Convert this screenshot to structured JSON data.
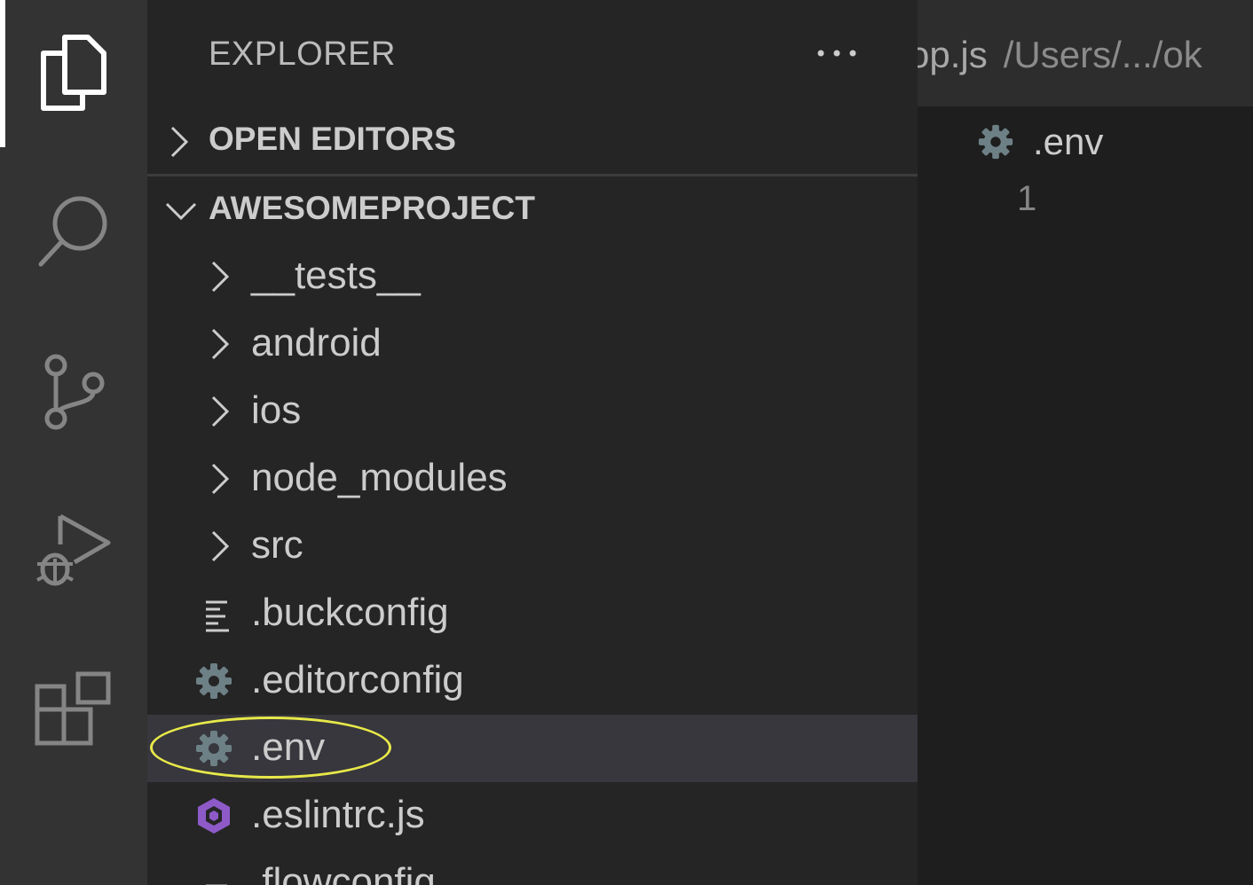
{
  "sidebar": {
    "title": "EXPLORER",
    "sections": [
      {
        "label": "OPEN EDITORS",
        "expanded": false
      },
      {
        "label": "AWESOMEPROJECT",
        "expanded": true
      }
    ],
    "tree": [
      {
        "name": "__tests__",
        "type": "folder"
      },
      {
        "name": "android",
        "type": "folder"
      },
      {
        "name": "ios",
        "type": "folder"
      },
      {
        "name": "node_modules",
        "type": "folder"
      },
      {
        "name": "src",
        "type": "folder"
      },
      {
        "name": ".buckconfig",
        "type": "file",
        "icon": "lines-icon"
      },
      {
        "name": ".editorconfig",
        "type": "file",
        "icon": "gear-icon"
      },
      {
        "name": ".env",
        "type": "file",
        "icon": "gear-icon",
        "selected": true
      },
      {
        "name": ".eslintrc.js",
        "type": "file",
        "icon": "eslint-icon"
      },
      {
        "name": ".flowconfig",
        "type": "file",
        "icon": "lines-icon"
      }
    ]
  },
  "editor": {
    "tab_title": "op.js",
    "tab_path": "/Users/.../ok",
    "breadcrumb": ".env",
    "line_number": "1"
  },
  "colors": {
    "activity_bar": "#333333",
    "sidebar": "#252526",
    "selection": "#37373d",
    "highlight_ring": "#e8e84a",
    "gear_icon": "#6d8086",
    "eslint_icon": "#8e5ac8"
  }
}
